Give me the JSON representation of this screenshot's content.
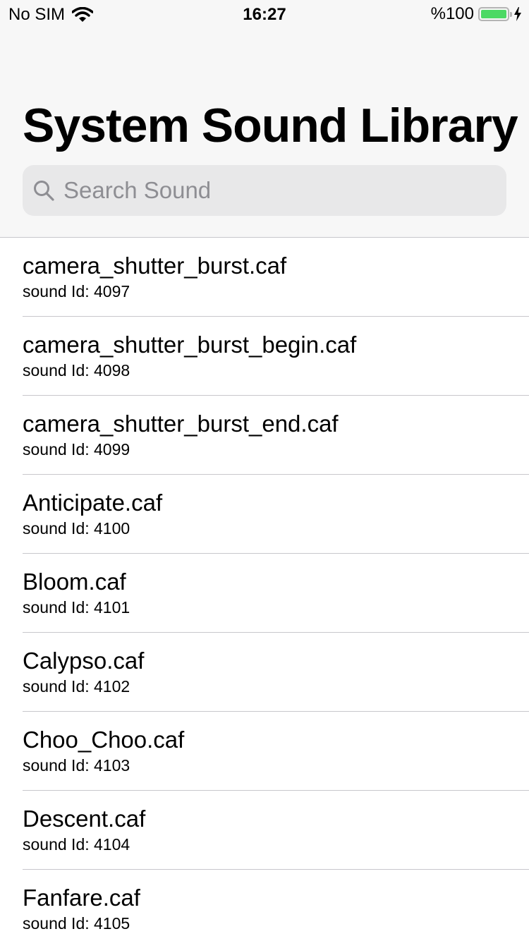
{
  "status_bar": {
    "carrier": "No SIM",
    "time": "16:27",
    "battery_percent": "%100",
    "battery_level": 1.0,
    "wifi_icon": "wifi-icon",
    "charging_icon": "bolt-icon"
  },
  "header": {
    "title": "System Sound Library"
  },
  "search": {
    "placeholder": "Search Sound",
    "value": "",
    "icon": "search-icon"
  },
  "colors": {
    "header_bg": "#f7f7f7",
    "search_bg": "#e8e8e9",
    "separator": "#c8c7cc",
    "battery_green": "#4cd964",
    "placeholder": "#8e8e93"
  },
  "sounds": [
    {
      "name": "camera_shutter_burst.caf",
      "id_label": "sound Id: 4097"
    },
    {
      "name": "camera_shutter_burst_begin.caf",
      "id_label": "sound Id: 4098"
    },
    {
      "name": "camera_shutter_burst_end.caf",
      "id_label": "sound Id: 4099"
    },
    {
      "name": "Anticipate.caf",
      "id_label": "sound Id: 4100"
    },
    {
      "name": "Bloom.caf",
      "id_label": "sound Id: 4101"
    },
    {
      "name": "Calypso.caf",
      "id_label": "sound Id: 4102"
    },
    {
      "name": "Choo_Choo.caf",
      "id_label": "sound Id: 4103"
    },
    {
      "name": "Descent.caf",
      "id_label": "sound Id: 4104"
    },
    {
      "name": "Fanfare.caf",
      "id_label": "sound Id: 4105"
    }
  ]
}
